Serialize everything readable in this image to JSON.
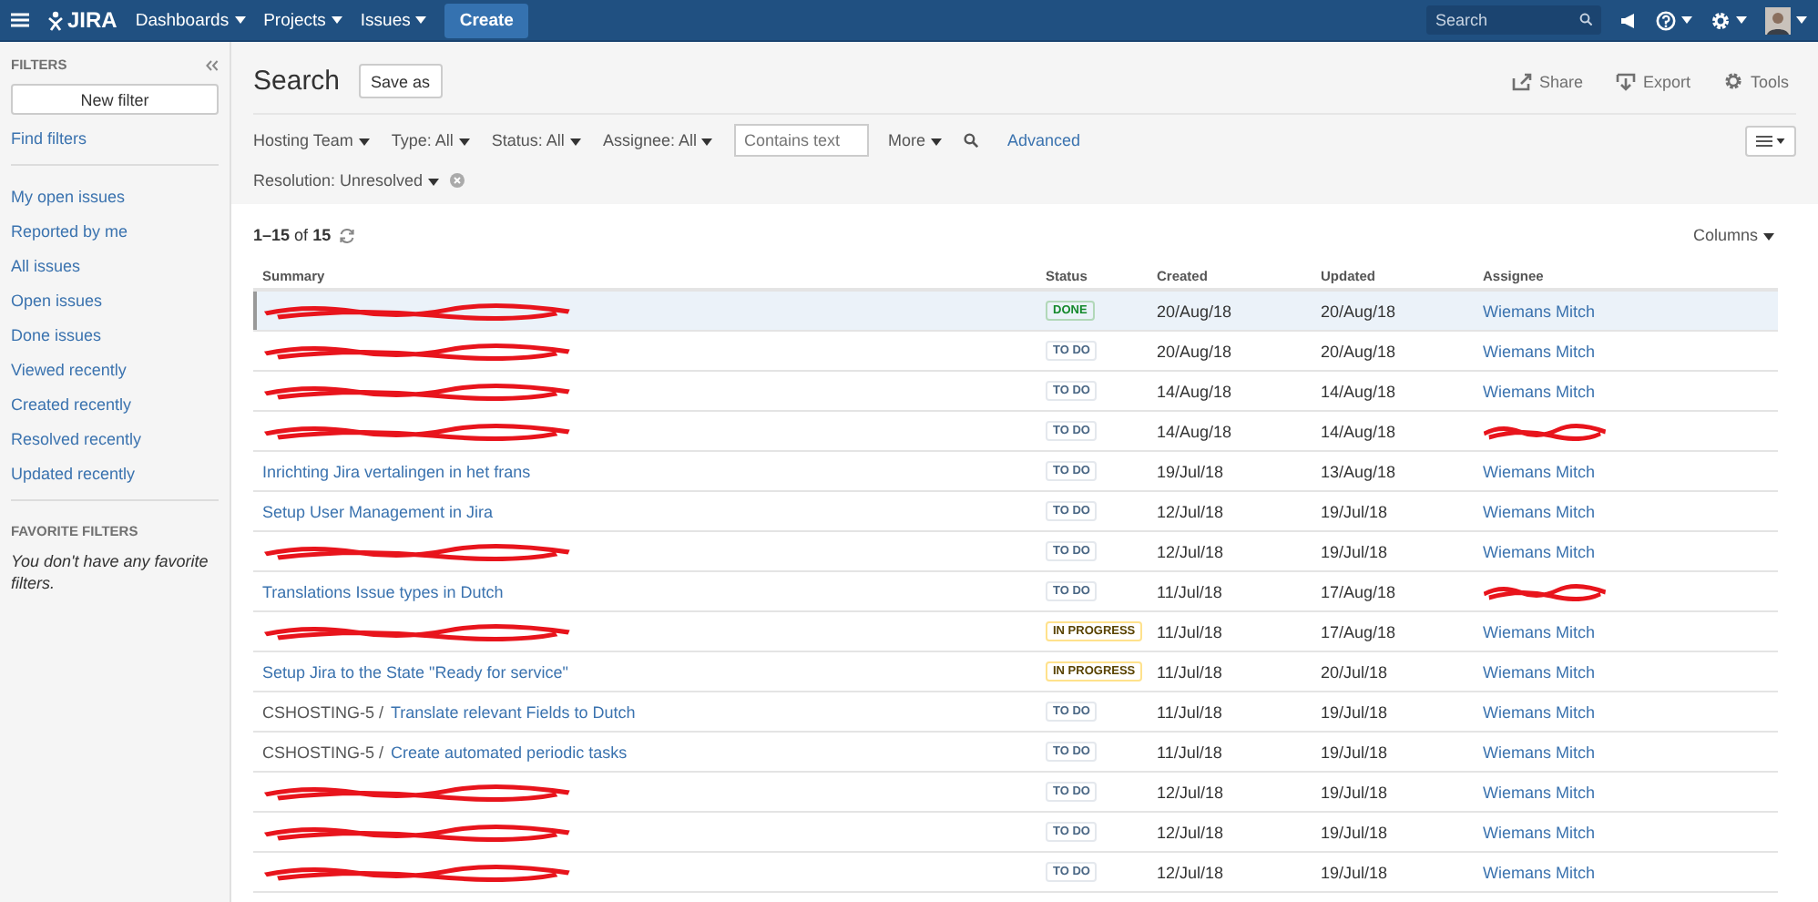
{
  "topbar": {
    "logo": "JIRA",
    "menus": [
      "Dashboards",
      "Projects",
      "Issues"
    ],
    "create": "Create",
    "search": {
      "placeholder": "Search"
    }
  },
  "sidebar": {
    "heading": "FILTERS",
    "new_filter": "New filter",
    "find_filters": "Find filters",
    "items": [
      "My open issues",
      "Reported by me",
      "All issues",
      "Open issues",
      "Done issues",
      "Viewed recently",
      "Created recently",
      "Resolved recently",
      "Updated recently"
    ],
    "favorites_heading": "FAVORITE FILTERS",
    "favorites_empty": "You don't have any favorite filters."
  },
  "header": {
    "title": "Search",
    "save_as": "Save as",
    "actions": [
      {
        "kind": "share",
        "label": "Share"
      },
      {
        "kind": "export",
        "label": "Export"
      },
      {
        "kind": "tools",
        "label": "Tools"
      }
    ]
  },
  "filters": {
    "dropdowns": [
      "Hosting Team",
      "Type: All",
      "Status: All",
      "Assignee: All"
    ],
    "text": {
      "placeholder": "Contains text"
    },
    "more": "More",
    "advanced": "Advanced",
    "resolution": "Resolution: Unresolved"
  },
  "results": {
    "count_from": "1–15",
    "count_of": "of",
    "count_total": "15",
    "columns_button": "Columns"
  },
  "table": {
    "columns": [
      "Summary",
      "Status",
      "Created",
      "Updated",
      "Assignee"
    ],
    "rows": [
      {
        "selected": true,
        "redacted": true,
        "status": {
          "kind": "done",
          "label": "DONE"
        },
        "created": "20/Aug/18",
        "updated": "20/Aug/18",
        "assignee": "Wiemans Mitch"
      },
      {
        "selected": false,
        "redacted": true,
        "status": {
          "kind": "todo",
          "label": "TO DO"
        },
        "created": "20/Aug/18",
        "updated": "20/Aug/18",
        "assignee": "Wiemans Mitch"
      },
      {
        "selected": false,
        "redacted": true,
        "status": {
          "kind": "todo",
          "label": "TO DO"
        },
        "created": "14/Aug/18",
        "updated": "14/Aug/18",
        "assignee": "Wiemans Mitch"
      },
      {
        "selected": false,
        "redacted": true,
        "status": {
          "kind": "todo",
          "label": "TO DO"
        },
        "created": "14/Aug/18",
        "updated": "14/Aug/18",
        "assignee_redacted": true
      },
      {
        "selected": false,
        "title": "Inrichting Jira vertalingen in het frans",
        "status": {
          "kind": "todo",
          "label": "TO DO"
        },
        "created": "19/Jul/18",
        "updated": "13/Aug/18",
        "assignee": "Wiemans Mitch"
      },
      {
        "selected": false,
        "title": "Setup User Management in Jira",
        "status": {
          "kind": "todo",
          "label": "TO DO"
        },
        "created": "12/Jul/18",
        "updated": "19/Jul/18",
        "assignee": "Wiemans Mitch"
      },
      {
        "selected": false,
        "redacted": true,
        "status": {
          "kind": "todo",
          "label": "TO DO"
        },
        "created": "12/Jul/18",
        "updated": "19/Jul/18",
        "assignee": "Wiemans Mitch"
      },
      {
        "selected": false,
        "title": "Translations Issue types in Dutch",
        "status": {
          "kind": "todo",
          "label": "TO DO"
        },
        "created": "11/Jul/18",
        "updated": "17/Aug/18",
        "assignee_redacted": true
      },
      {
        "selected": false,
        "redacted": true,
        "status": {
          "kind": "inprogress",
          "label": "IN PROGRESS"
        },
        "created": "11/Jul/18",
        "updated": "17/Aug/18",
        "assignee": "Wiemans Mitch"
      },
      {
        "selected": false,
        "title": "Setup Jira to the State \"Ready for service\"",
        "status": {
          "kind": "inprogress",
          "label": "IN PROGRESS"
        },
        "created": "11/Jul/18",
        "updated": "20/Jul/18",
        "assignee": "Wiemans Mitch"
      },
      {
        "selected": false,
        "key": "CSHOSTING-5 /",
        "title": "Translate relevant Fields to Dutch",
        "status": {
          "kind": "todo",
          "label": "TO DO"
        },
        "created": "11/Jul/18",
        "updated": "19/Jul/18",
        "assignee": "Wiemans Mitch"
      },
      {
        "selected": false,
        "key": "CSHOSTING-5 /",
        "title": "Create automated periodic tasks",
        "status": {
          "kind": "todo",
          "label": "TO DO"
        },
        "created": "11/Jul/18",
        "updated": "19/Jul/18",
        "assignee": "Wiemans Mitch"
      },
      {
        "selected": false,
        "redacted": true,
        "status": {
          "kind": "todo",
          "label": "TO DO"
        },
        "created": "12/Jul/18",
        "updated": "19/Jul/18",
        "assignee": "Wiemans Mitch"
      },
      {
        "selected": false,
        "redacted": true,
        "status": {
          "kind": "todo",
          "label": "TO DO"
        },
        "created": "12/Jul/18",
        "updated": "19/Jul/18",
        "assignee": "Wiemans Mitch"
      },
      {
        "selected": false,
        "redacted": true,
        "status": {
          "kind": "todo",
          "label": "TO DO"
        },
        "created": "12/Jul/18",
        "updated": "19/Jul/18",
        "assignee": "Wiemans Mitch"
      }
    ]
  }
}
